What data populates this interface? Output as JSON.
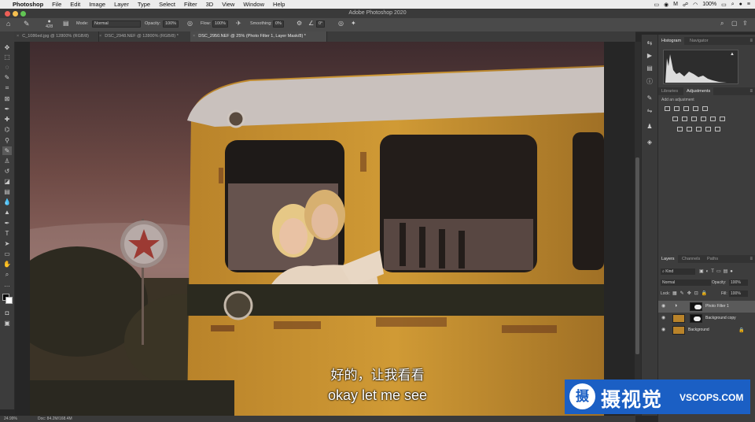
{
  "menubar": {
    "app": "Photoshop",
    "items": [
      "File",
      "Edit",
      "Image",
      "Layer",
      "Type",
      "Select",
      "Filter",
      "3D",
      "View",
      "Window",
      "Help"
    ],
    "battery": "100%",
    "time": ""
  },
  "window": {
    "title": "Adobe Photoshop 2020"
  },
  "options": {
    "brush_size": "428",
    "mode_label": "Mode:",
    "mode_value": "Normal",
    "opacity_label": "Opacity:",
    "opacity_value": "100%",
    "flow_label": "Flow:",
    "flow_value": "100%",
    "smoothing_label": "Smoothing:",
    "smoothing_value": "0%",
    "angle_value": "0°"
  },
  "tabs": [
    {
      "label": "C_1086ed.jpg @ 12800% (RGB/8)",
      "active": false
    },
    {
      "label": "DSC_2948.NEF @ 12800% (RGB/8) *",
      "active": false
    },
    {
      "label": "DSC_2950.NEF @ 25% (Photo Filter 1, Layer Mask/8) *",
      "active": true
    }
  ],
  "status": {
    "zoom": "24.99%",
    "doc": "Doc: 84.2M/168.4M"
  },
  "panels": {
    "top_tabs": [
      "Histogram",
      "Navigator"
    ],
    "mid_tabs": [
      "Libraries",
      "Adjustments"
    ],
    "add_adjustment": "Add an adjustment",
    "layer_tabs": [
      "Layers",
      "Channels",
      "Paths"
    ],
    "kind_label": "Kind",
    "blend_mode": "Normal",
    "opacity_label": "Opacity:",
    "opacity_value": "100%",
    "lock_label": "Lock:",
    "fill_label": "Fill:",
    "fill_value": "100%",
    "layers": [
      {
        "name": "Photo Filter 1",
        "selected": true
      },
      {
        "name": "Background copy",
        "selected": false
      },
      {
        "name": "Background",
        "selected": false
      }
    ]
  },
  "subtitles": {
    "cn": "好的，让我看看",
    "en": "okay let me see"
  },
  "watermark": {
    "logo": "摄",
    "cn": "摄视觉",
    "en": "VSCOPS.COM"
  },
  "colors": {
    "accent": "#1b5fc4",
    "bus_yellow": "#c7902a"
  }
}
